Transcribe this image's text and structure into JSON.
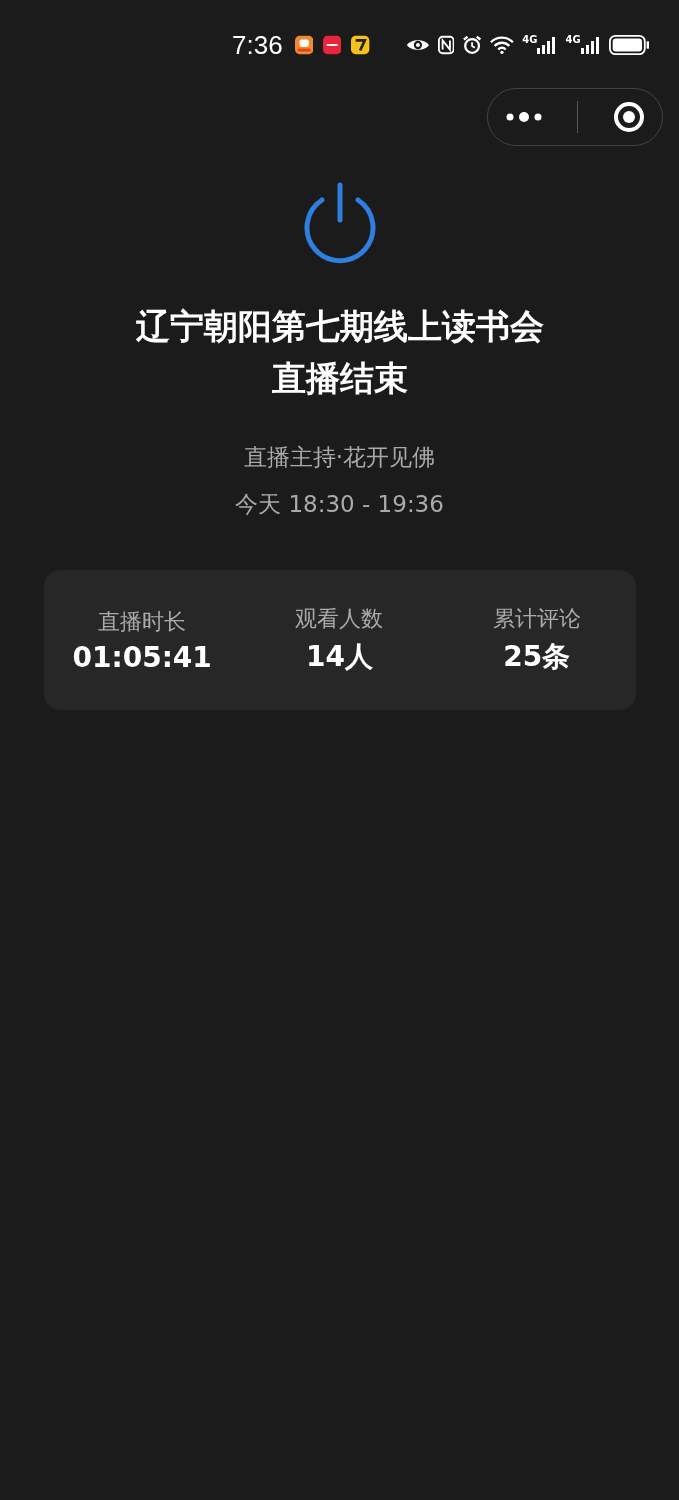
{
  "status_bar": {
    "time": "7:36",
    "signals": [
      {
        "label": "4G"
      },
      {
        "label": "4G"
      }
    ]
  },
  "title_lines": [
    "辽宁朝阳第七期线上读书会",
    "直播结束"
  ],
  "host": "直播主持·花开见佛",
  "schedule": "今天 18:30 - 19:36",
  "stats": [
    {
      "label": "直播时长",
      "value": "01:05:41"
    },
    {
      "label": "观看人数",
      "value": "14人"
    },
    {
      "label": "累计评论",
      "value": "25条"
    }
  ]
}
